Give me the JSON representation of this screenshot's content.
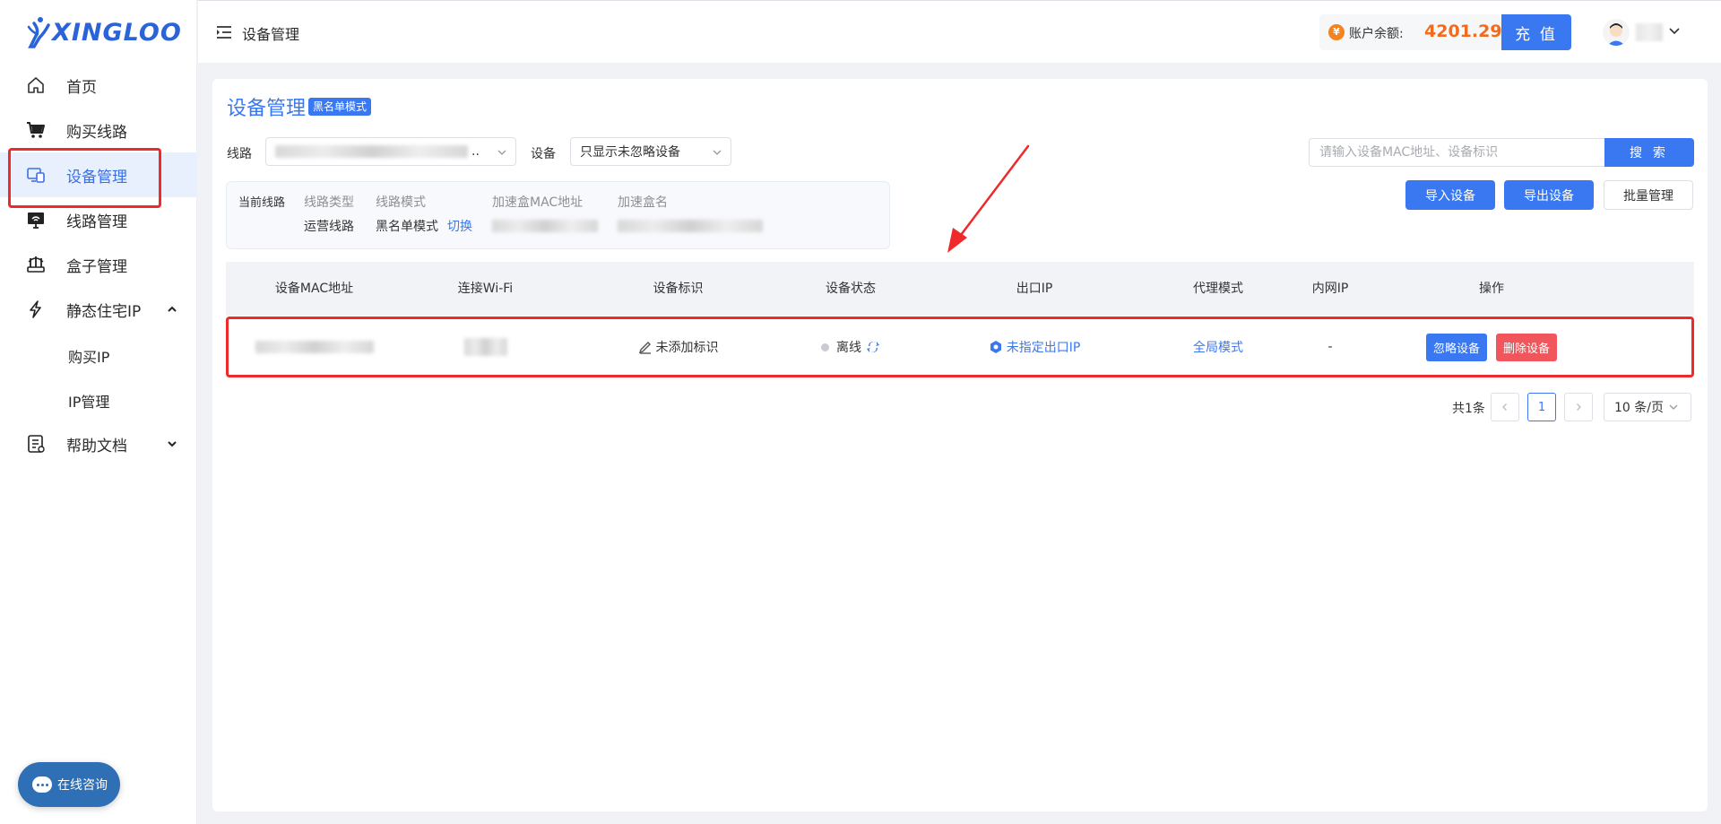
{
  "brand": {
    "name": "XINGLOO",
    "color": "#2a64d7"
  },
  "sidebar": {
    "items": [
      {
        "label": "首页",
        "icon": "home-icon"
      },
      {
        "label": "购买线路",
        "icon": "cart-icon"
      },
      {
        "label": "设备管理",
        "icon": "device-icon",
        "active": true
      },
      {
        "label": "线路管理",
        "icon": "monitor-icon"
      },
      {
        "label": "盒子管理",
        "icon": "router-icon"
      },
      {
        "label": "静态住宅IP",
        "icon": "lightning-icon",
        "expanded": true
      },
      {
        "label": "帮助文档",
        "icon": "doc-icon",
        "expanded": false
      }
    ],
    "sub_items": [
      {
        "label": "购买IP"
      },
      {
        "label": "IP管理"
      }
    ],
    "chat_label": "在线咨询"
  },
  "header": {
    "title": "设备管理",
    "balance_label": "账户余额:",
    "balance_value": "4201.29",
    "currency_symbol": "¥",
    "recharge_label": "充 值"
  },
  "main": {
    "title": "设备管理",
    "mode_tag": "黑名单模式",
    "filters": {
      "line_label": "线路",
      "line_value_suffix": "..",
      "device_label": "设备",
      "device_value": "只显示未忽略设备"
    },
    "search": {
      "placeholder": "请输入设备MAC地址、设备标识",
      "button": "搜 索"
    },
    "actions": {
      "import": "导入设备",
      "export": "导出设备",
      "batch": "批量管理"
    },
    "info": {
      "current_line_label": "当前线路",
      "line_type_label": "线路类型",
      "line_type_value": "运营线路",
      "line_mode_label": "线路模式",
      "line_mode_value": "黑名单模式",
      "switch_link": "切换",
      "box_mac_label": "加速盒MAC地址",
      "box_name_label": "加速盒名"
    },
    "table": {
      "headers": [
        "设备MAC地址",
        "连接Wi-Fi",
        "设备标识",
        "设备状态",
        "出口IP",
        "代理模式",
        "内网IP",
        "操作"
      ],
      "rows": [
        {
          "tag": "未添加标识",
          "status": "离线",
          "exit_ip": "未指定出口IP",
          "proxy_mode": "全局模式",
          "lan_ip": "-",
          "ignore_btn": "忽略设备",
          "delete_btn": "删除设备"
        }
      ]
    },
    "pagination": {
      "total": "共1条",
      "current_page": "1",
      "page_size": "10 条/页"
    }
  },
  "colors": {
    "accent": "#3a78f2",
    "danger": "#f0565b",
    "annotation": "#ee2a2a",
    "balance": "#f26b1d"
  }
}
